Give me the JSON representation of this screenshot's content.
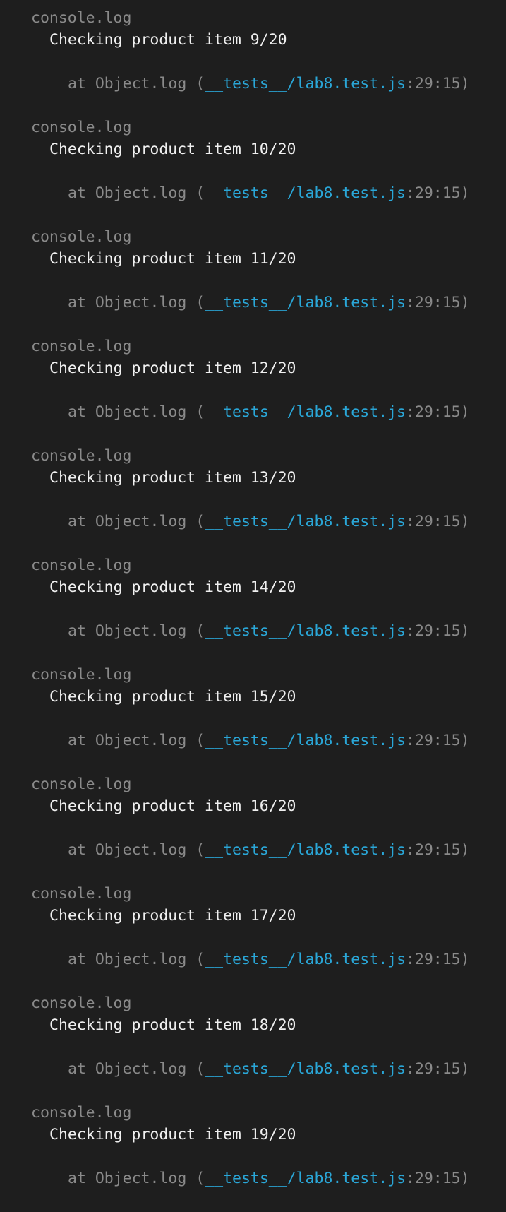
{
  "entries": [
    {
      "source": "console.log",
      "message": "Checking product item 9/20",
      "at_prefix": "at Object.log (",
      "file": "__tests__/lab8.test.js",
      "location": ":29:15)"
    },
    {
      "source": "console.log",
      "message": "Checking product item 10/20",
      "at_prefix": "at Object.log (",
      "file": "__tests__/lab8.test.js",
      "location": ":29:15)"
    },
    {
      "source": "console.log",
      "message": "Checking product item 11/20",
      "at_prefix": "at Object.log (",
      "file": "__tests__/lab8.test.js",
      "location": ":29:15)"
    },
    {
      "source": "console.log",
      "message": "Checking product item 12/20",
      "at_prefix": "at Object.log (",
      "file": "__tests__/lab8.test.js",
      "location": ":29:15)"
    },
    {
      "source": "console.log",
      "message": "Checking product item 13/20",
      "at_prefix": "at Object.log (",
      "file": "__tests__/lab8.test.js",
      "location": ":29:15)"
    },
    {
      "source": "console.log",
      "message": "Checking product item 14/20",
      "at_prefix": "at Object.log (",
      "file": "__tests__/lab8.test.js",
      "location": ":29:15)"
    },
    {
      "source": "console.log",
      "message": "Checking product item 15/20",
      "at_prefix": "at Object.log (",
      "file": "__tests__/lab8.test.js",
      "location": ":29:15)"
    },
    {
      "source": "console.log",
      "message": "Checking product item 16/20",
      "at_prefix": "at Object.log (",
      "file": "__tests__/lab8.test.js",
      "location": ":29:15)"
    },
    {
      "source": "console.log",
      "message": "Checking product item 17/20",
      "at_prefix": "at Object.log (",
      "file": "__tests__/lab8.test.js",
      "location": ":29:15)"
    },
    {
      "source": "console.log",
      "message": "Checking product item 18/20",
      "at_prefix": "at Object.log (",
      "file": "__tests__/lab8.test.js",
      "location": ":29:15)"
    },
    {
      "source": "console.log",
      "message": "Checking product item 19/20",
      "at_prefix": "at Object.log (",
      "file": "__tests__/lab8.test.js",
      "location": ":29:15)"
    }
  ],
  "colors": {
    "background": "#1e1e1e",
    "dim_text": "#8a8a8a",
    "message_text": "#f0f0f0",
    "link": "#2aa7d8"
  }
}
